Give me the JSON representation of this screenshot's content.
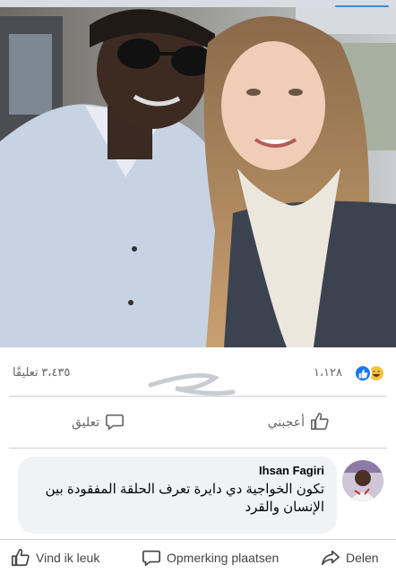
{
  "post": {
    "reaction_count": "١،١٢٨",
    "comment_count": "٣،٤٣٥ تعليقًا",
    "reaction_icons": [
      "like-icon",
      "haha-icon"
    ]
  },
  "actions": {
    "like_label": "أعجبني",
    "comment_label": "تعليق"
  },
  "comment": {
    "author": "Ihsan Fagiri",
    "text": "تكون الخواجية دي دايرة تعرف الحلقة المفقودة بين الإنسان والقرد"
  },
  "bottom_bar": {
    "like_label": "Vind ik leuk",
    "comment_label": "Opmerking plaatsen",
    "share_label": "Delen"
  },
  "colors": {
    "facebook_blue": "#1877f2",
    "haha_yellow": "#f7c244",
    "muted_text": "#65676b",
    "bubble_bg": "#f0f2f5"
  }
}
